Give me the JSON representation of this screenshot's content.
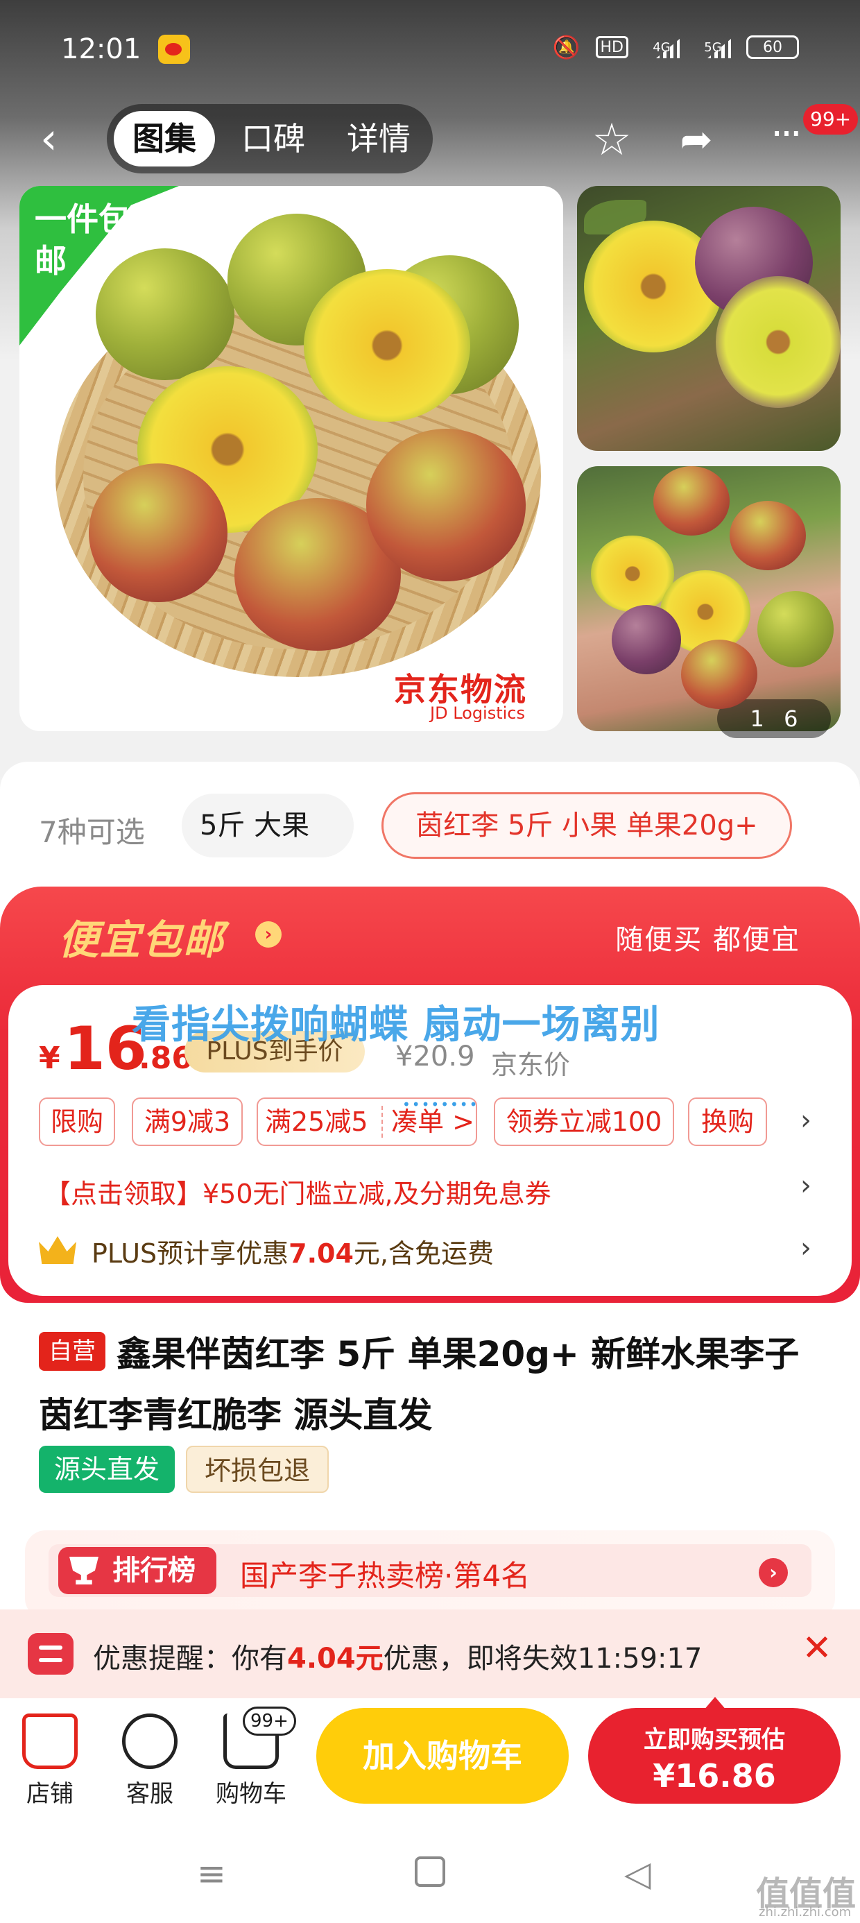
{
  "status_bar": {
    "time": "12:01",
    "hd": "HD",
    "net1": "4G",
    "net2": "5G",
    "battery": "60"
  },
  "nav": {
    "tabs": [
      "图集",
      "口碑",
      "详情"
    ],
    "badge": "99+"
  },
  "gallery": {
    "tag_free": "一件包邮",
    "logistics_cn": "京东物流",
    "logistics_en": "JD Logistics",
    "pager": "1 6"
  },
  "specs": {
    "count": "7种可选",
    "option1": "5斤 大果",
    "option2": "茵红李 5斤 小果 单果20g+"
  },
  "promo": {
    "title": "便宜包邮",
    "subtitle": "随便买 都便宜",
    "lyric": "看指尖拨响蝴蝶  扇动一场离别",
    "price_symbol": "¥",
    "price_int": "16",
    "price_dec": ".86",
    "plus_label": "PLUS到手价",
    "jd_price": "¥20.9",
    "jd_price_label": "京东价",
    "coupons": [
      "限购",
      "满9减3",
      "满25减5",
      "凑单 >",
      "领券立减100",
      "换购"
    ],
    "line1": "【点击领取】¥50无门槛立减,及分期免息券",
    "plus_line_pre": "PLUS预计享优惠",
    "plus_line_amount": "7.04",
    "plus_line_post": "元,含免运费"
  },
  "product": {
    "self_tag": "自营",
    "title": "鑫果伴茵红李 5斤 单果20g+ 新鲜水果李子茵红李青红脆李 源头直发",
    "tag_green": "源头直发",
    "tag_beige": "坏损包退"
  },
  "rank": {
    "tag": "排行榜",
    "text": "国产李子热卖榜·第4名"
  },
  "reminder": {
    "pre": "优惠提醒：你有",
    "amount": "4.04元",
    "mid": "优惠，即将失效",
    "time": "11:59:17"
  },
  "bottom": {
    "shop": "店铺",
    "service": "客服",
    "cart": "购物车",
    "cart_badge": "99+",
    "add_cart": "加入购物车",
    "buy_line1": "立即购买预估",
    "buy_line2": "¥16.86"
  },
  "watermark": {
    "main": "值值值",
    "sub": "zhi.zhi.zhi.com"
  },
  "colors": {
    "brand_red": "#e3241b",
    "promo_red": "#eb2a39",
    "gold": "#ffd778",
    "cart_yellow": "#ffcd0a",
    "green": "#14b36b"
  }
}
